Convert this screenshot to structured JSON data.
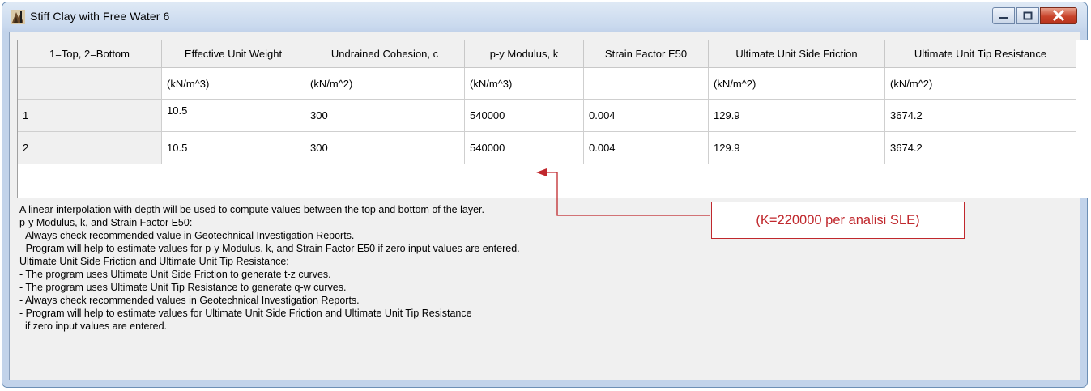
{
  "window": {
    "title": "Stiff Clay with Free Water  6",
    "icon": "soil-layer-icon"
  },
  "table": {
    "columns": [
      "1=Top, 2=Bottom",
      "Effective Unit Weight",
      "Undrained Cohesion, c",
      "p-y Modulus, k",
      "Strain Factor E50",
      "Ultimate Unit Side Friction",
      "Ultimate Unit Tip Resistance"
    ],
    "units": [
      "",
      "(kN/m^3)",
      "(kN/m^2)",
      "(kN/m^3)",
      "",
      "(kN/m^2)",
      "(kN/m^2)"
    ],
    "rows": [
      [
        "1",
        "10.5",
        "300",
        "540000",
        "0.004",
        "129.9",
        "3674.2"
      ],
      [
        "2",
        "10.5",
        "300",
        "540000",
        "0.004",
        "129.9",
        "3674.2"
      ]
    ]
  },
  "notes": [
    "A linear interpolation with depth will be used to compute values between the top and bottom of the layer.",
    "p-y Modulus, k, and Strain Factor E50:",
    "- Always check recommended value in Geotechnical Investigation Reports.",
    "- Program will help to estimate values for p-y Modulus, k, and Strain Factor E50 if zero input values are entered.",
    "Ultimate Unit Side Friction and Ultimate Unit Tip Resistance:",
    "- The program uses Ultimate Unit Side Friction to generate t-z curves.",
    "- The program uses Ultimate Unit Tip Resistance to generate q-w curves.",
    "- Always check recommended values in Geotechnical Investigation Reports.",
    "- Program will help to estimate values for Ultimate Unit Side Friction and Ultimate Unit Tip Resistance",
    "  if zero input values are entered."
  ],
  "annotation": {
    "text": "(K=220000 per analisi SLE)",
    "color": "#c0282d"
  }
}
